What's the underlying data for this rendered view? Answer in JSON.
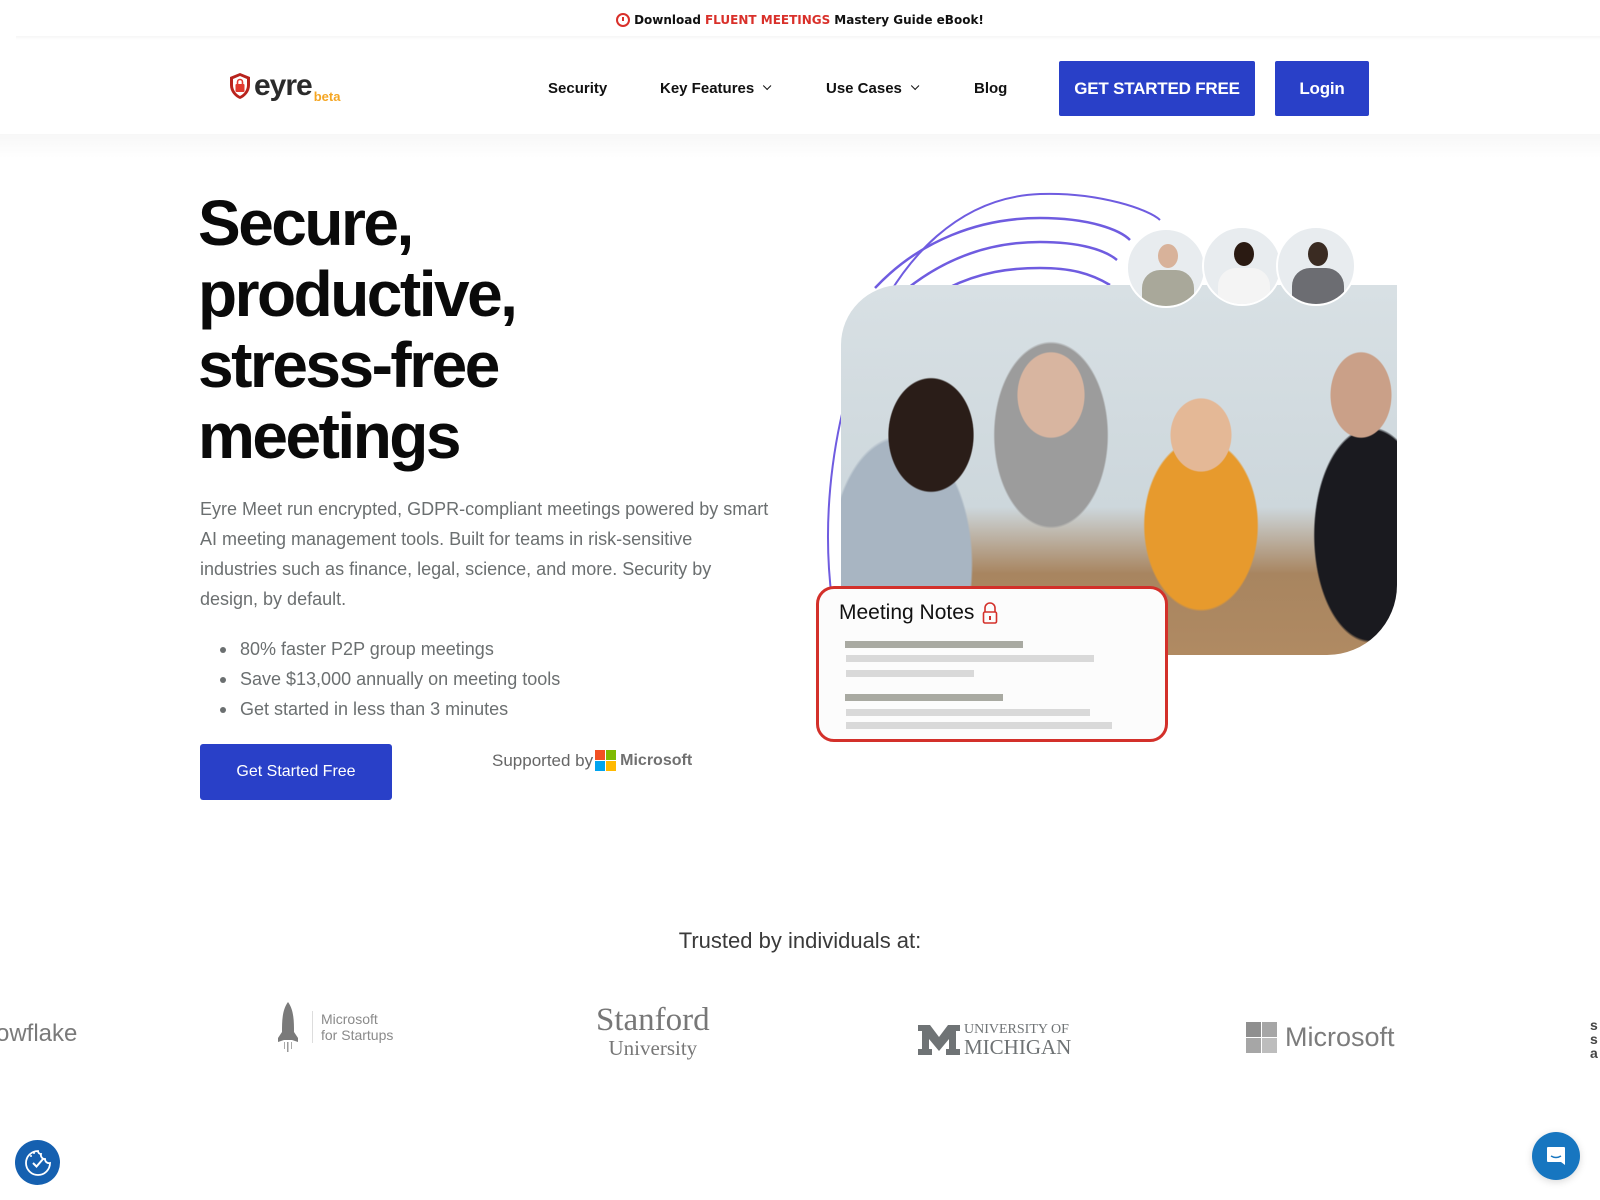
{
  "announcement": {
    "prefix": "Download",
    "highlight": "FLUENT MEETINGS",
    "suffix": "Mastery Guide eBook!",
    "highlight_color": "#d9302a"
  },
  "header": {
    "logo_text": "eyre",
    "logo_badge": "beta",
    "nav": [
      {
        "label": "Security",
        "has_dropdown": false
      },
      {
        "label": "Key Features",
        "has_dropdown": true
      },
      {
        "label": "Use Cases",
        "has_dropdown": true
      },
      {
        "label": "Blog",
        "has_dropdown": false
      }
    ],
    "cta_label": "GET STARTED FREE",
    "login_label": "Login",
    "brand_color": "#2940c8"
  },
  "hero": {
    "title_lines": [
      "Secure,",
      "productive,",
      "stress-free",
      "meetings"
    ],
    "description": "Eyre Meet run encrypted, GDPR-compliant meetings powered by smart AI meeting management tools. Built for teams in risk-sensitive industries such as finance, legal, science, and more. Security by design, by default.",
    "bullets": [
      "80% faster P2P group meetings",
      "Save $13,000 annually on meeting tools",
      "Get started in less than 3 minutes"
    ],
    "cta_label": "Get Started Free",
    "supported_by": "Supported by",
    "supporter": "Microsoft"
  },
  "illustration": {
    "notes_title": "Meeting Notes",
    "accent_color": "#d3302a",
    "arc_color": "#6f5ce0"
  },
  "trusted": {
    "heading": "Trusted by individuals at:",
    "logos": [
      {
        "name": "Snowflake",
        "visible_text": "owflake"
      },
      {
        "name": "Microsoft for Startups",
        "line1": "Microsoft",
        "line2": "for Startups"
      },
      {
        "name": "Stanford University",
        "line1": "Stanford",
        "line2": "University"
      },
      {
        "name": "University of Michigan",
        "line1": "UNIVERSITY OF",
        "line2": "MICHIGAN"
      },
      {
        "name": "Microsoft",
        "visible_text": "Microsoft"
      }
    ]
  },
  "widgets": {
    "cookie_icon": "cookie-consent-icon",
    "chat_icon": "chat-icon"
  }
}
